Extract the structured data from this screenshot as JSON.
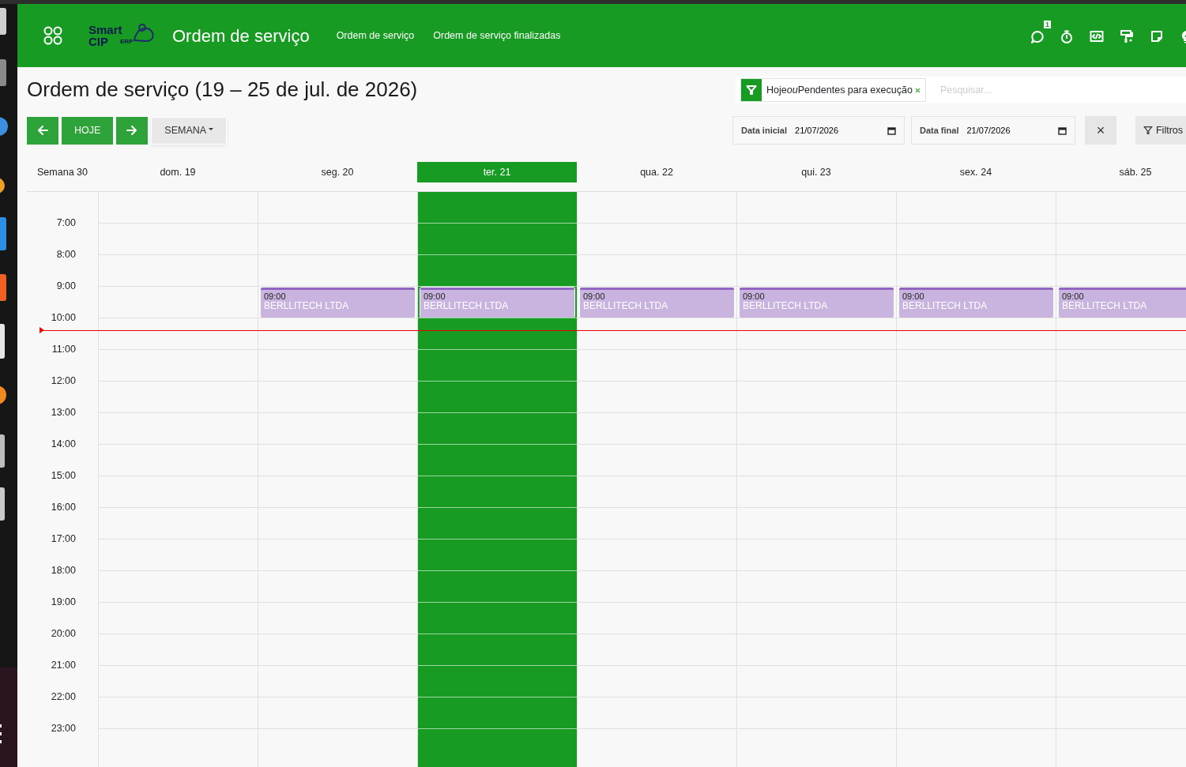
{
  "navbar": {
    "app_title": "Ordem de serviço",
    "logo": {
      "line1": "Smart",
      "line2": "CIP",
      "tag": "ERP"
    },
    "links": [
      "Ordem de serviço",
      "Ordem de serviço finalizadas"
    ],
    "chat_badge": "1"
  },
  "page_title": "Ordem de serviço (19 – 25 de jul. de 2026)",
  "filter": {
    "chip": {
      "first": "Hoje",
      "joiner": "ou",
      "second": "Pendentes para execução"
    },
    "search_placeholder": "Pesquisar..."
  },
  "toolbar": {
    "today": "HOJE",
    "view": "SEMANA"
  },
  "date_fields": [
    {
      "label": "Data inicial",
      "value": "21/07/2026"
    },
    {
      "label": "Data final",
      "value": "21/07/2026"
    }
  ],
  "clear_button": "×",
  "filters_button": "Filtros",
  "calendar": {
    "week_label": "Semana 30",
    "days": [
      {
        "label": "dom. 19",
        "selected": false
      },
      {
        "label": "seg. 20",
        "selected": false,
        "events": [
          {
            "time": "09:00",
            "title": "BERLLITECH LTDA"
          }
        ]
      },
      {
        "label": "ter. 21",
        "selected": true,
        "events": [
          {
            "time": "09:00",
            "title": "BERLLITECH LTDA"
          }
        ]
      },
      {
        "label": "qua. 22",
        "selected": false,
        "events": [
          {
            "time": "09:00",
            "title": "BERLLITECH LTDA"
          }
        ]
      },
      {
        "label": "qui. 23",
        "selected": false,
        "events": [
          {
            "time": "09:00",
            "title": "BERLLITECH LTDA"
          }
        ]
      },
      {
        "label": "sex. 24",
        "selected": false,
        "events": [
          {
            "time": "09:00",
            "title": "BERLLITECH LTDA"
          }
        ]
      },
      {
        "label": "sáb. 25",
        "selected": false,
        "events": [
          {
            "time": "09:00",
            "title": "BERLLITECH LTDA"
          }
        ]
      }
    ],
    "hours": [
      "7:00",
      "8:00",
      "9:00",
      "10:00",
      "11:00",
      "12:00",
      "13:00",
      "14:00",
      "15:00",
      "16:00",
      "17:00",
      "18:00",
      "19:00",
      "20:00",
      "21:00",
      "22:00",
      "23:00"
    ]
  }
}
